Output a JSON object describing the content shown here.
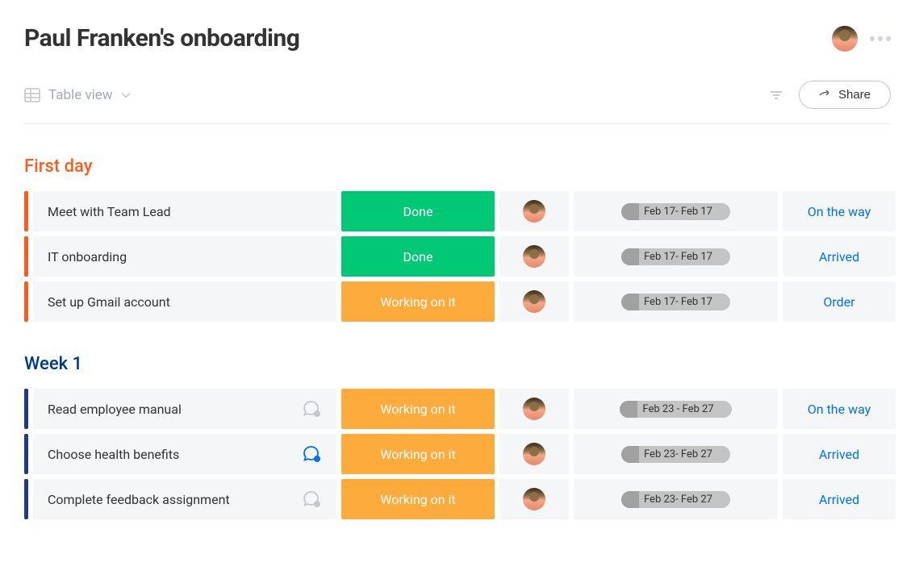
{
  "header": {
    "title": "Paul Franken's onboarding"
  },
  "toolbar": {
    "view_label": "Table view",
    "share_label": "Share"
  },
  "groups": [
    {
      "id": "first-day",
      "title": "First day",
      "color": "orange",
      "rows": [
        {
          "task": "Meet with Team Lead",
          "chat": "none",
          "status": "Done",
          "status_class": "status-done",
          "date": "Feb 17- Feb 17",
          "action": "On the way"
        },
        {
          "task": "IT onboarding",
          "chat": "none",
          "status": "Done",
          "status_class": "status-done",
          "date": "Feb 17- Feb 17",
          "action": "Arrived"
        },
        {
          "task": "Set up Gmail account",
          "chat": "none",
          "status": "Working on it",
          "status_class": "status-working",
          "date": "Feb 17- Feb 17",
          "action": "Order"
        }
      ]
    },
    {
      "id": "week-1",
      "title": "Week 1",
      "color": "navy",
      "rows": [
        {
          "task": "Read employee manual",
          "chat": "empty",
          "status": "Working on it",
          "status_class": "status-working",
          "date": "Feb 23 - Feb 27",
          "action": "On the way"
        },
        {
          "task": "Choose health benefits",
          "chat": "active",
          "status": "Working on it",
          "status_class": "status-working",
          "date": "Feb 23- Feb 27",
          "action": "Arrived"
        },
        {
          "task": "Complete feedback assignment",
          "chat": "empty",
          "status": "Working on it",
          "status_class": "status-working",
          "date": "Feb 23- Feb 27",
          "action": "Arrived"
        }
      ]
    }
  ]
}
